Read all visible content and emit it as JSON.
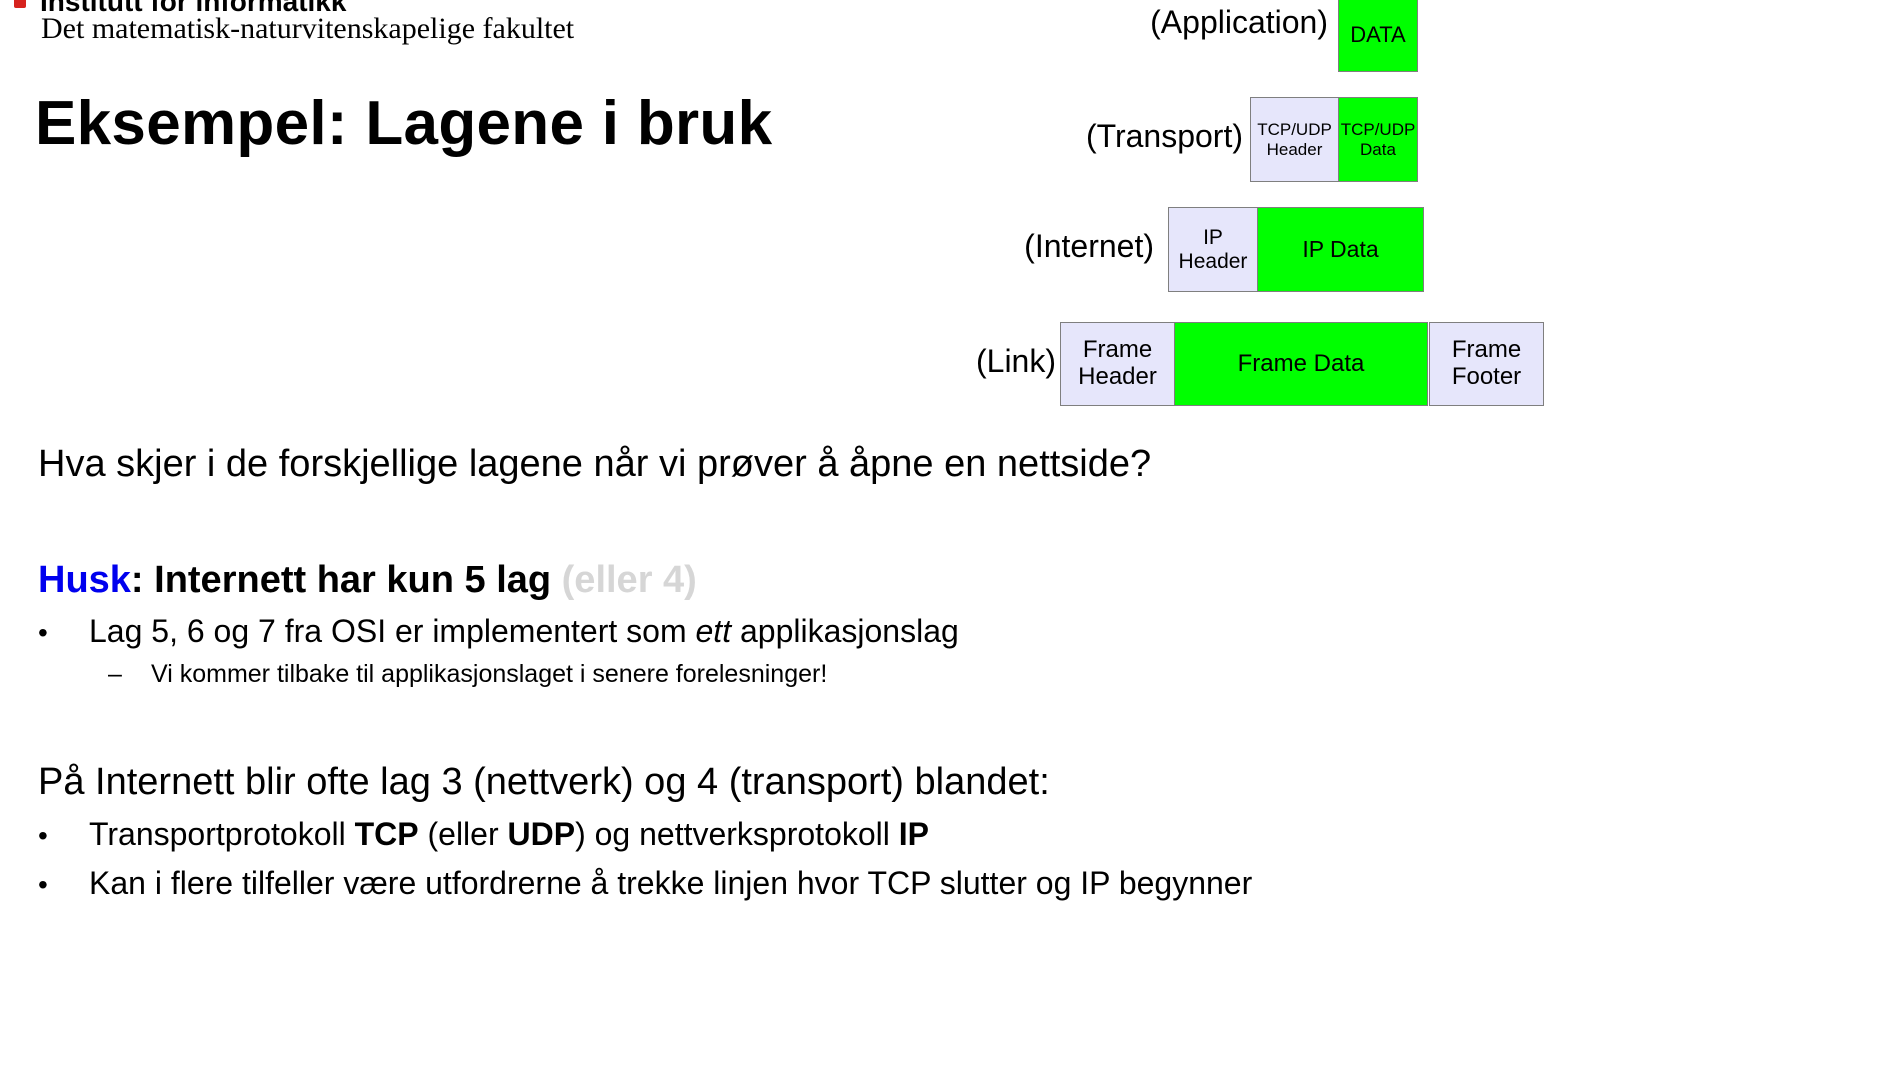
{
  "header": {
    "institute": "Institutt for informatikk",
    "faculty": "Det matematisk-naturvitenskapelige fakultet"
  },
  "title": "Eksempel: Lagene i bruk",
  "diagram": {
    "application": {
      "label": "(Application)",
      "data": "DATA"
    },
    "transport": {
      "label": "(Transport)",
      "header_1": "TCP/UDP",
      "header_2": "Header",
      "data_1": "TCP/UDP",
      "data_2": "Data"
    },
    "internet": {
      "label": "(Internet)",
      "header_1": "IP",
      "header_2": "Header",
      "data": "IP Data"
    },
    "link": {
      "label": "(Link)",
      "header_1": "Frame",
      "header_2": "Header",
      "data": "Frame Data",
      "footer_1": "Frame",
      "footer_2": "Footer"
    }
  },
  "question": "Hva skjer i de forskjellige lagene når vi prøver å åpne en nettside?",
  "remember": {
    "keyword": "Husk",
    "text": ": Internett har kun 5 lag ",
    "aside": "(eller 4)",
    "bullet_pre": "Lag 5, 6 og 7 fra OSI er implementert som ",
    "bullet_em": "ett",
    "bullet_post": " applikasjonslag",
    "sub": "Vi kommer tilbake til applikasjonslaget i senere forelesninger!"
  },
  "mixing": {
    "text": "På Internett blir ofte lag 3 (nettverk) og 4 (transport) blandet:",
    "b1_pre": "Transportprotokoll ",
    "b1_tcp": "TCP",
    "b1_mid": " (eller ",
    "b1_udp": "UDP",
    "b1_mid2": ") og nettverksprotokoll ",
    "b1_ip": "IP",
    "b2": "Kan i flere tilfeller være utfordrerne å trekke linjen hvor TCP slutter og IP begynner"
  },
  "symbols": {
    "bullet": "•",
    "dash": "–"
  },
  "colors": {
    "data": "#00ff00",
    "header": "#e6e6fb",
    "accent": "#0000ee",
    "muted": "#d6d6d6",
    "logo": "#d6231e"
  }
}
